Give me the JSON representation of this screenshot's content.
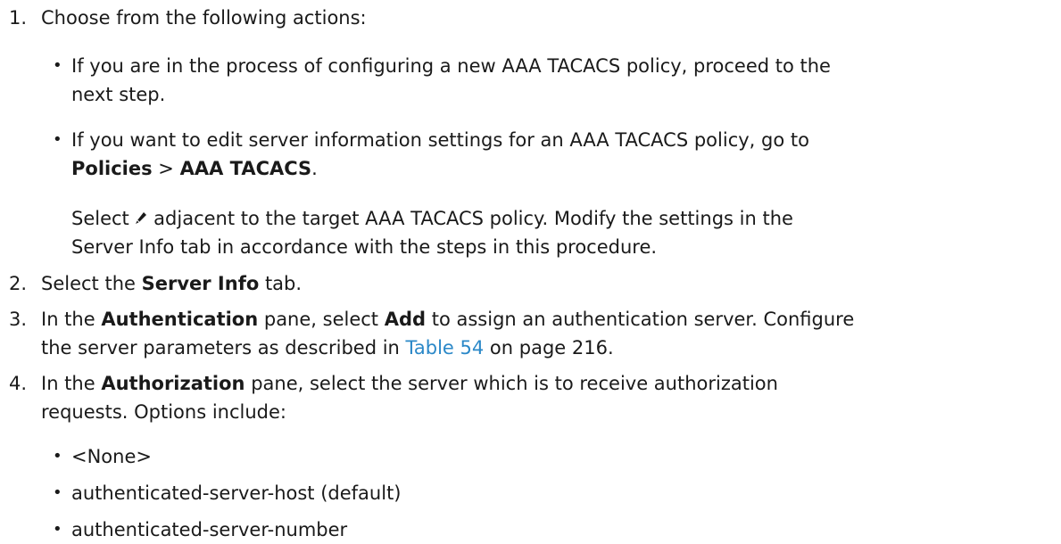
{
  "steps": [
    {
      "num": "1.",
      "text": "Choose from the following actions:",
      "bullets": [
        {
          "line1": "If you are in the process of configuring a new AAA TACACS policy, proceed to the",
          "line2": "next step."
        },
        {
          "line1": "If you want to edit server information settings for an AAA TACACS policy, go to",
          "bold_a": "Policies",
          "sep": " > ",
          "bold_b": "AAA TACACS",
          "end": "."
        }
      ],
      "para": {
        "pre": "Select",
        "icon": "pencil-icon",
        "post": "adjacent to the target AAA TACACS policy. Modify the settings in the",
        "line2": "Server Info tab in accordance with the steps in this procedure."
      }
    },
    {
      "num": "2.",
      "pre": "Select the ",
      "bold": "Server Info",
      "post": " tab."
    },
    {
      "num": "3.",
      "pre": "In the ",
      "bold_a": "Authentication",
      "mid": " pane, select ",
      "bold_b": "Add",
      "post": " to assign an authentication server. Configure",
      "line2_pre": "the server parameters as described in ",
      "link": "Table 54",
      "line2_post": " on page 216."
    },
    {
      "num": "4.",
      "pre": "In the ",
      "bold": "Authorization",
      "post": " pane, select the server which is to receive authorization",
      "line2": "requests. Options include:",
      "options": [
        "<None>",
        "authenticated-server-host (default)",
        "authenticated-server-number"
      ]
    }
  ],
  "bullet_char": "•",
  "colors": {
    "text": "#1a1a1a",
    "link": "#2b88c8"
  }
}
